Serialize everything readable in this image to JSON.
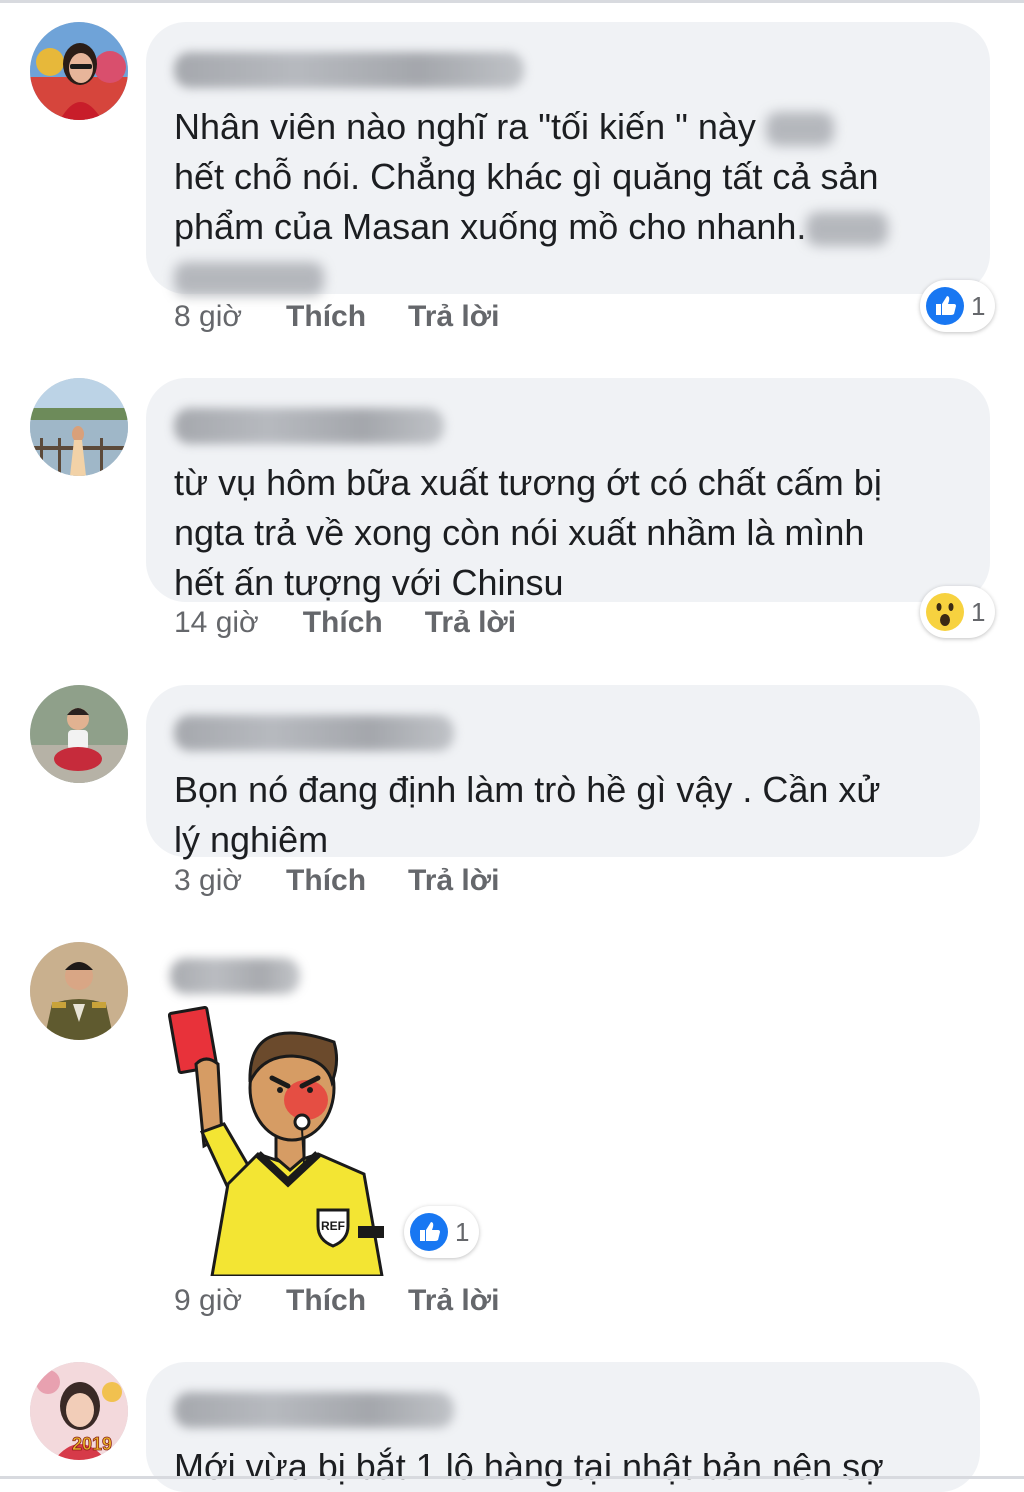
{
  "comments": [
    {
      "text_before_blur": "Nhân viên nào nghĩ ra \"tối kiến \" này ",
      "text_mid": "hết chỗ nói. Chẳng khác gì quăng tất cả sản\nphẩm của Masan xuống mồ cho nhanh.",
      "time": "8 giờ",
      "like": "Thích",
      "reply": "Trả lời",
      "reaction_icon": "like-icon",
      "reaction_count": "1"
    },
    {
      "text": "từ vụ hôm bữa xuất tương ớt có chất cấm bị\nngta trả về xong còn nói xuất nhầm là mình\nhết ấn tượng với Chinsu",
      "time": "14 giờ",
      "like": "Thích",
      "reply": "Trả lời",
      "reaction_icon": "wow-icon",
      "reaction_count": "1"
    },
    {
      "text": "Bọn nó đang định làm trò hề gì vậy . Cần xử\nlý nghiêm",
      "time": "3 giờ",
      "like": "Thích",
      "reply": "Trả lời"
    },
    {
      "sticker_icon": "referee-red-card-sticker",
      "sticker_badge": "REF",
      "time": "9 giờ",
      "like": "Thích",
      "reply": "Trả lời",
      "reaction_icon": "like-icon",
      "reaction_count": "1"
    },
    {
      "text": "Mới vừa bị bắt 1 lô hàng tại nhật bản nên sợ",
      "avatar_badge": "2019"
    }
  ],
  "colors": {
    "bubble": "#f0f2f5",
    "text": "#1c1e21",
    "meta": "#65676b",
    "like_blue": "#1877f2",
    "wow_yellow": "#f7d23f",
    "card_red": "#e8323a",
    "shirt_yellow": "#f3e533"
  }
}
